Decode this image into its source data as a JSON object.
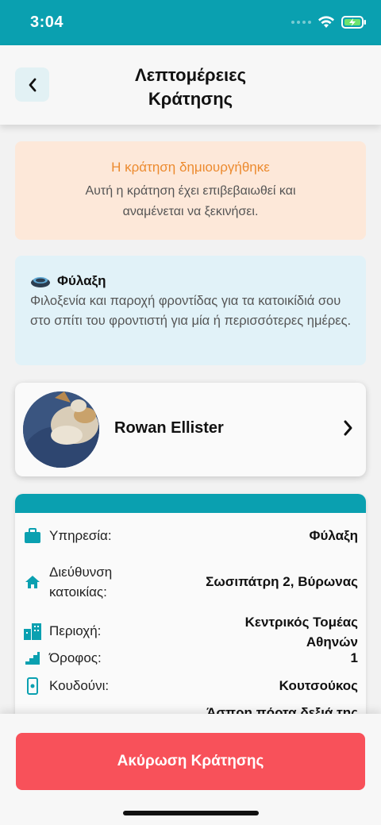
{
  "status_bar": {
    "time": "3:04",
    "wifi_icon": "wifi-icon",
    "battery_icon": "battery-charging-icon"
  },
  "header": {
    "title": "Λεπτομέρειες Κράτησης",
    "back_icon": "chevron-left-icon"
  },
  "notice": {
    "title": "Η κράτηση δημιουργήθηκε",
    "text_line1": "Αυτή η κράτηση έχει επιβεβαιωθεί και",
    "text_line2": "αναμένεται να ξεκινήσει."
  },
  "service": {
    "icon": "pet-bed-icon",
    "title": "Φύλαξη",
    "description": "Φιλοξενία και παροχή φροντίδας για τα κατοικίδιά σου στο σπίτι του φροντιστή για μία ή περισσότερες ημέρες."
  },
  "caretaker": {
    "name": "Rowan Ellister"
  },
  "details": {
    "rows": [
      {
        "icon": "briefcase-icon",
        "label": "Υπηρεσία:",
        "value": "Φύλαξη"
      },
      {
        "icon": "home-icon",
        "label": "Διεύθυνση κατοικίας:",
        "value": "Σωσιπάτρη 2, Βύρωνας"
      },
      {
        "icon": "buildings-icon",
        "label": "Περιοχή:",
        "value": "Κεντρικός Τομέας Αθηνών"
      },
      {
        "icon": "stairs-icon",
        "label": "Όροφος:",
        "value": "1"
      },
      {
        "icon": "doorbell-icon",
        "label": "Κουδούνι:",
        "value": "Κουτσούκος"
      },
      {
        "icon": "info-icon",
        "label": "",
        "value": "Άσπρη πόρτα δεξιά της"
      }
    ]
  },
  "footer": {
    "cancel_label": "Ακύρωση Κράτησης"
  },
  "colors": {
    "accent": "#0aa0b0",
    "danger": "#f8515a",
    "notice_bg": "#fde8d9",
    "notice_title": "#ec8a2e",
    "service_bg": "#e1f2f8"
  }
}
